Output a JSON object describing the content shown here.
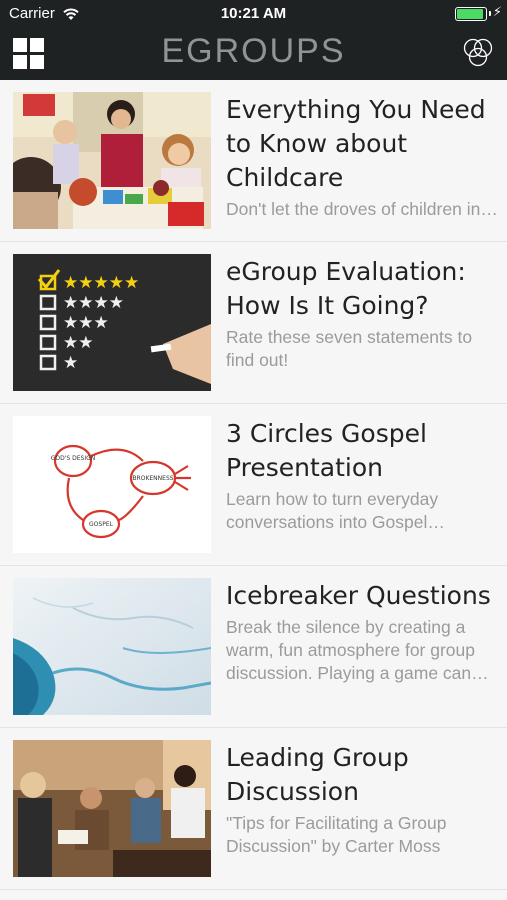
{
  "status_bar": {
    "carrier": "Carrier",
    "time": "10:21 AM",
    "battery_level": 1.0,
    "battery_color": "#4cd964"
  },
  "nav": {
    "title": "EGROUPS",
    "left_icon": "grid-menu-icon",
    "right_icon": "overlapping-circles-icon"
  },
  "articles": [
    {
      "title": "Everything You Need to Know about Childcare",
      "description": "Don't let the droves of children in your church scare you away from starting an eGroup",
      "image": "childcare-photo"
    },
    {
      "title": "eGroup Evaluation: How Is It Going?",
      "description": "Rate these seven statements to find out!",
      "image": "star-rating-chalkboard-photo"
    },
    {
      "title": "3 Circles Gospel Presentation",
      "description": "Learn how to turn everyday conversations into Gospel conversations",
      "image": "three-circles-diagram",
      "diagram_labels": [
        "GOD'S DESIGN",
        "BROKENNESS",
        "GOSPEL"
      ]
    },
    {
      "title": "Icebreaker Questions",
      "description": "Break the silence by creating a warm, fun atmosphere for group discussion. Playing a game can help",
      "image": "ice-aerial-photo"
    },
    {
      "title": "Leading Group Discussion",
      "description": "\"Tips for Facilitating a Group Discussion\" by Carter Moss",
      "image": "group-discussion-photo"
    }
  ]
}
